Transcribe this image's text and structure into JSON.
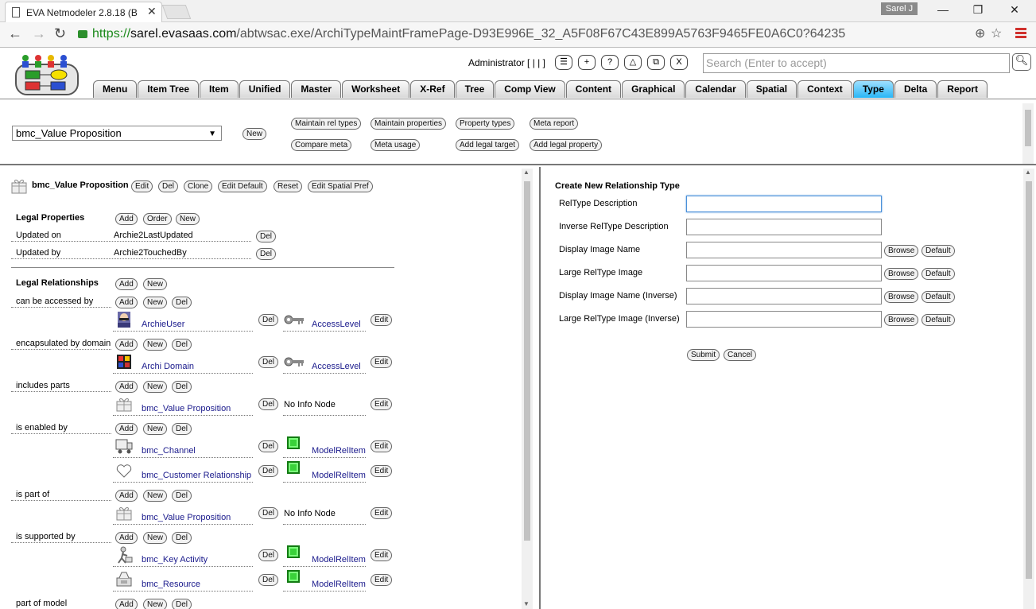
{
  "browser": {
    "tab_title": "EVA Netmodeler 2.8.18 (B",
    "user_badge": "Sarel J",
    "url_protocol": "https://",
    "url_host": "sarel.evasaas.com",
    "url_path": "/abtwsac.exe/ArchiTypeMaintFramePage-D93E996E_32_A5F08F67C43E899A5763F9465FE0A6C0?64235"
  },
  "header": {
    "admin_label": "Administrator [ | | ]",
    "icon_buttons": [
      "☰",
      "+",
      "?",
      "△",
      "⧉",
      "X"
    ],
    "search_placeholder": "Search (Enter to accept)",
    "tabs": [
      "Menu",
      "Item Tree",
      "Item",
      "Unified",
      "Master",
      "Worksheet",
      "X-Ref",
      "Tree",
      "Comp View",
      "Content",
      "Graphical",
      "Calendar",
      "Spatial",
      "Context",
      "Type",
      "Delta",
      "Report"
    ],
    "active_tab": "Type"
  },
  "toolbar": {
    "selected_type": "bmc_Value Proposition",
    "new_label": "New",
    "buttons_row1": [
      "Maintain rel types",
      "Maintain properties",
      "Property types",
      "Meta report"
    ],
    "buttons_row2": [
      "Compare meta",
      "Meta usage",
      "Add legal target",
      "Add legal property"
    ]
  },
  "left": {
    "type_name": "bmc_Value Proposition",
    "type_actions": [
      "Edit",
      "Del",
      "Clone",
      "Edit Default",
      "Reset",
      "Edit Spatial Pref"
    ],
    "legal_properties_title": "Legal Properties",
    "legal_properties_actions": [
      "Add",
      "Order",
      "New"
    ],
    "properties": [
      {
        "label": "Updated on",
        "value": "Archie2LastUpdated",
        "action": "Del"
      },
      {
        "label": "Updated by",
        "value": "Archie2TouchedBy",
        "action": "Del"
      }
    ],
    "legal_relationships_title": "Legal Relationships",
    "legal_relationships_actions": [
      "Add",
      "New"
    ],
    "relationships": [
      {
        "label": "can be accessed by",
        "actions": [
          "Add",
          "New",
          "Del"
        ],
        "targets": [
          {
            "name": "ArchieUser",
            "icon": "user-icon",
            "del": "Del",
            "kind": "AccessLevel",
            "kind_icon": "key-icon",
            "edit": "Edit"
          }
        ]
      },
      {
        "label": "encapsulated by domain",
        "actions": [
          "Add",
          "New",
          "Del"
        ],
        "targets": [
          {
            "name": "Archi Domain",
            "icon": "domain-icon",
            "del": "Del",
            "kind": "AccessLevel",
            "kind_icon": "key-icon",
            "edit": "Edit"
          }
        ]
      },
      {
        "label": "includes parts",
        "actions": [
          "Add",
          "New",
          "Del"
        ],
        "targets": [
          {
            "name": "bmc_Value Proposition",
            "icon": "gift-icon",
            "del": "Del",
            "kind": "No Info Node",
            "kind_icon": "",
            "edit": "Edit"
          }
        ]
      },
      {
        "label": "is enabled by",
        "actions": [
          "Add",
          "New",
          "Del"
        ],
        "targets": [
          {
            "name": "bmc_Channel",
            "icon": "truck-icon",
            "del": "Del",
            "kind": "ModelRelItem",
            "kind_icon": "green-box-icon",
            "edit": "Edit"
          },
          {
            "name": "bmc_Customer Relationship",
            "icon": "heart-icon",
            "del": "Del",
            "kind": "ModelRelItem",
            "kind_icon": "green-box-icon",
            "edit": "Edit"
          }
        ]
      },
      {
        "label": "is part of",
        "actions": [
          "Add",
          "New",
          "Del"
        ],
        "targets": [
          {
            "name": "bmc_Value Proposition",
            "icon": "gift-icon",
            "del": "Del",
            "kind": "No Info Node",
            "kind_icon": "",
            "edit": "Edit"
          }
        ]
      },
      {
        "label": "is supported by",
        "actions": [
          "Add",
          "New",
          "Del"
        ],
        "targets": [
          {
            "name": "bmc_Key Activity",
            "icon": "activity-icon",
            "del": "Del",
            "kind": "ModelRelItem",
            "kind_icon": "green-box-icon",
            "edit": "Edit"
          },
          {
            "name": "bmc_Resource",
            "icon": "resource-icon",
            "del": "Del",
            "kind": "ModelRelItem",
            "kind_icon": "green-box-icon",
            "edit": "Edit"
          }
        ]
      },
      {
        "label": "part of model",
        "actions": [
          "Add",
          "New",
          "Del"
        ],
        "targets": []
      }
    ]
  },
  "right": {
    "form_title": "Create New Relationship Type",
    "fields": [
      {
        "label": "RelType Description",
        "value": "",
        "buttons": []
      },
      {
        "label": "Inverse RelType Description",
        "value": "",
        "buttons": []
      },
      {
        "label": "Display Image Name",
        "value": "",
        "buttons": [
          "Browse",
          "Default"
        ]
      },
      {
        "label": "Large RelType Image",
        "value": "",
        "buttons": [
          "Browse",
          "Default"
        ]
      },
      {
        "label": "Display Image Name (Inverse)",
        "value": "",
        "buttons": [
          "Browse",
          "Default"
        ]
      },
      {
        "label": "Large RelType Image (Inverse)",
        "value": "",
        "buttons": [
          "Browse",
          "Default"
        ]
      }
    ],
    "submit_label": "Submit",
    "cancel_label": "Cancel"
  },
  "colors": {
    "active_tab": "#29b6f6",
    "link": "#1a1a8c",
    "menu_red": "#d0312d",
    "secure_green": "#1b8a1b"
  }
}
